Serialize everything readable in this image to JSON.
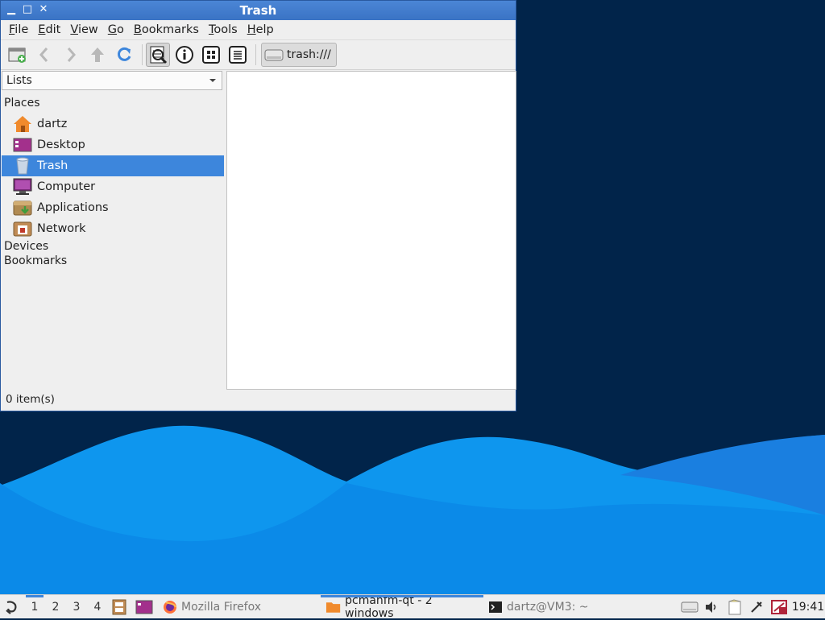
{
  "window": {
    "title": "Trash",
    "minimize_glyph": "▁",
    "maximize_glyph": "□",
    "close_glyph": "✕"
  },
  "menubar": [
    {
      "label": "File",
      "mnemonic": "F"
    },
    {
      "label": "Edit",
      "mnemonic": "E"
    },
    {
      "label": "View",
      "mnemonic": "V"
    },
    {
      "label": "Go",
      "mnemonic": "G"
    },
    {
      "label": "Bookmarks",
      "mnemonic": "B"
    },
    {
      "label": "Tools",
      "mnemonic": "T"
    },
    {
      "label": "Help",
      "mnemonic": "H"
    }
  ],
  "toolbar": {
    "icons": [
      "new-tab-icon",
      "back-icon",
      "forward-icon",
      "up-icon",
      "reload-icon",
      "icon-view-icon",
      "info-icon",
      "thumbnail-view-icon",
      "detail-view-icon"
    ],
    "path": "trash:///"
  },
  "sidepane": {
    "mode": "Lists",
    "sections": {
      "places": "Places",
      "devices": "Devices",
      "bookmarks": "Bookmarks"
    },
    "places": [
      {
        "label": "dartz",
        "icon": "home-icon"
      },
      {
        "label": "Desktop",
        "icon": "desktop-icon"
      },
      {
        "label": "Trash",
        "icon": "trash-icon",
        "selected": true
      },
      {
        "label": "Computer",
        "icon": "computer-icon"
      },
      {
        "label": "Applications",
        "icon": "applications-icon"
      },
      {
        "label": "Network",
        "icon": "network-icon"
      }
    ]
  },
  "statusbar": {
    "text": "0 item(s)"
  },
  "taskbar": {
    "workspaces": [
      "1",
      "2",
      "3",
      "4"
    ],
    "current_workspace": "1",
    "tasks": [
      {
        "label": "Mozilla Firefox",
        "icon": "firefox-icon"
      },
      {
        "label": "pcmanfm-qt - 2 windows",
        "icon": "folder-icon",
        "active": true
      },
      {
        "label": "dartz@VM3: ~",
        "icon": "terminal-icon"
      }
    ],
    "clock": "19:41"
  },
  "colors": {
    "desktop_bg": "#01244a",
    "wave_light": "#0f9af0",
    "wave_mid": "#1a7fe0",
    "selection": "#3d86dc",
    "titlebar": "#3a73c4"
  }
}
